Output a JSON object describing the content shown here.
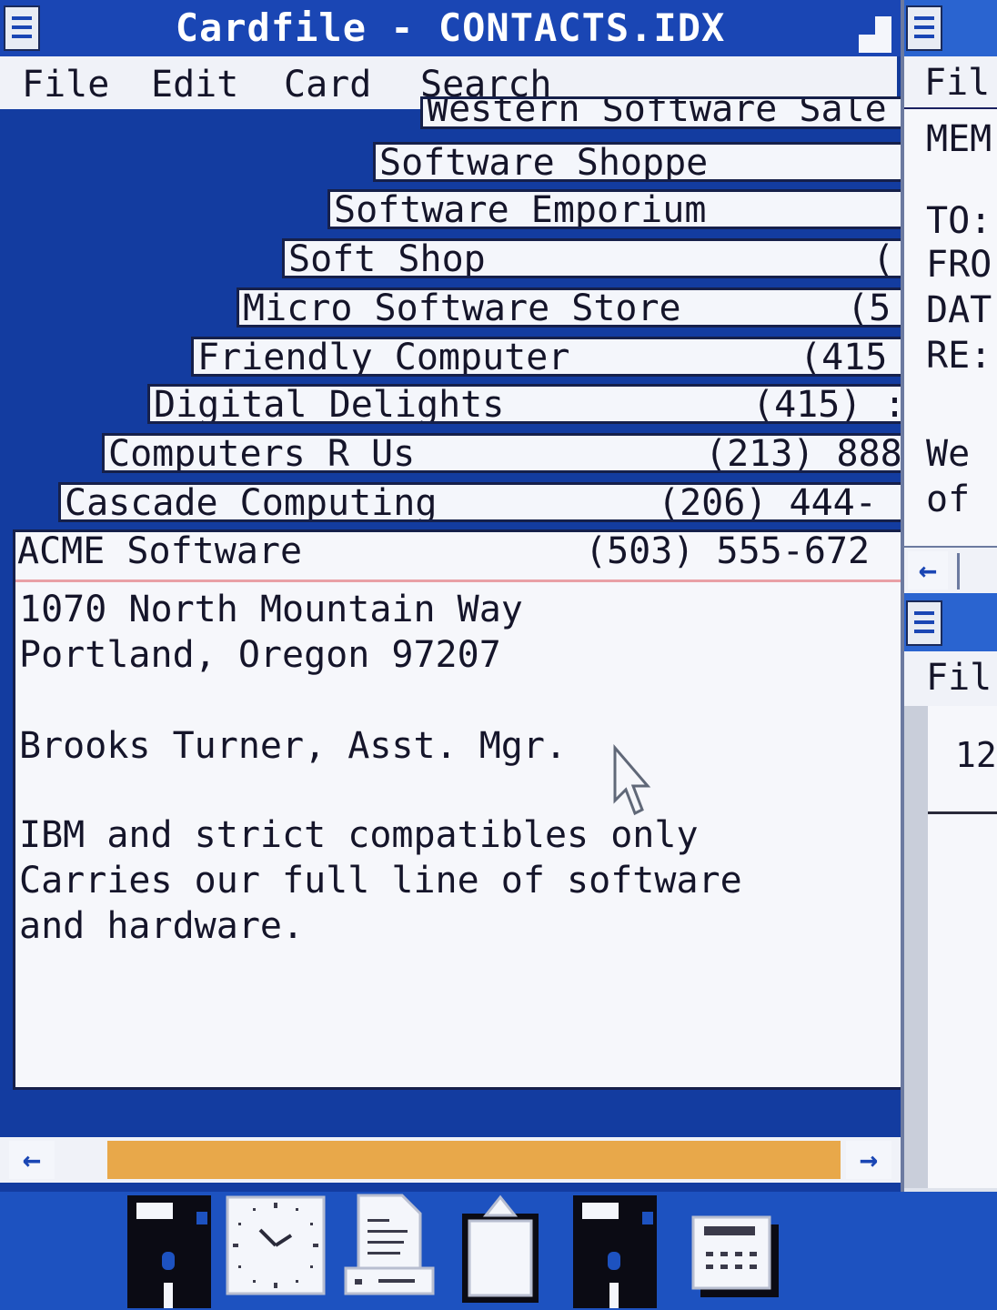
{
  "cardfile": {
    "title": "Cardfile - CONTACTS.IDX",
    "menu": [
      "File",
      "Edit",
      "Card",
      "Search"
    ],
    "stacked_cards": [
      {
        "name": "Western Software Sale",
        "phone": ""
      },
      {
        "name": "Software Shoppe",
        "phone": ""
      },
      {
        "name": "Software Emporium",
        "phone": ""
      },
      {
        "name": "Soft Shop",
        "phone": "(:"
      },
      {
        "name": "Micro Software Store",
        "phone": "(5"
      },
      {
        "name": "Friendly Computer",
        "phone": "(415"
      },
      {
        "name": "Digital Delights",
        "phone": "(415) :"
      },
      {
        "name": "Computers R Us",
        "phone": "(213) 888"
      },
      {
        "name": "Cascade Computing",
        "phone": "(206) 444-"
      }
    ],
    "front_card": {
      "name": "ACME Software",
      "phone": "(503) 555-672",
      "lines": [
        "1070 North Mountain Way",
        "Portland, Oregon 97207",
        "",
        "Brooks Turner, Asst. Mgr.",
        "",
        "IBM and strict compatibles only",
        "Carries our full line of software",
        "and hardware."
      ]
    },
    "scroll_left": "←",
    "scroll_right": "→"
  },
  "memo_window": {
    "menu_partial": "Fil",
    "lines": [
      "MEM",
      "",
      "TO:",
      "FRO",
      "DAT",
      "RE:",
      "",
      "We",
      "of"
    ],
    "scroll_left": "←"
  },
  "clock_window": {
    "menu_partial": "Fil",
    "value_partial": "12"
  },
  "icons": [
    "disk-icon",
    "clock-icon",
    "printer-icon",
    "clipboard-icon",
    "disk-icon",
    "calculator-icon"
  ],
  "colors": {
    "desktop": "#123a9a",
    "title_bar": "#1a46b4",
    "card_bg": "#f4f6fb",
    "scroll_thumb": "#e8a84a",
    "divider": "#e9a0a6"
  }
}
